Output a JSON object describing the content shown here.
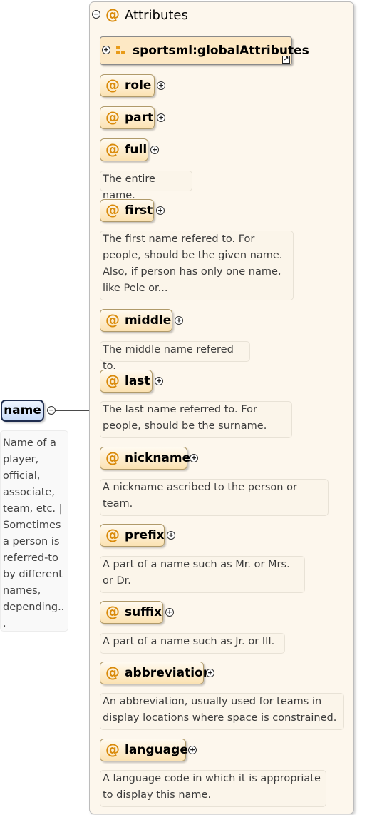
{
  "root": {
    "name": "name",
    "doc_lines": [
      "Name of a",
      "player,",
      "official,",
      "associate,",
      "team, etc. |",
      "Sometimes",
      "a person is",
      "referred-to",
      "by different",
      "names,",
      "depending..",
      "."
    ]
  },
  "group": {
    "title": "Attributes",
    "at_symbol": "@",
    "global_attributes": "sportsml:globalAttributes"
  },
  "attributes": [
    {
      "name": "role",
      "doc_lines": []
    },
    {
      "name": "part",
      "doc_lines": []
    },
    {
      "name": "full",
      "doc_lines": [
        "The entire name."
      ]
    },
    {
      "name": "first",
      "doc_lines": [
        "The first name refered to. For",
        "people, should be the given name.",
        "Also, if person has only one name,",
        "like Pele or..."
      ]
    },
    {
      "name": "middle",
      "doc_lines": [
        "The middle name refered to."
      ]
    },
    {
      "name": "last",
      "doc_lines": [
        "The last name referred to. For",
        "people, should be the surname."
      ]
    },
    {
      "name": "nickname",
      "doc_lines": [
        "A nickname ascribed to the person or",
        "team."
      ]
    },
    {
      "name": "prefix",
      "doc_lines": [
        "A part of a name such as Mr. or Mrs.",
        "or Dr."
      ]
    },
    {
      "name": "suffix",
      "doc_lines": [
        "A part of a name such as Jr. or III."
      ]
    },
    {
      "name": "abbreviation",
      "doc_lines": [
        "An abbreviation, usually used for teams in",
        "display locations where space is constrained."
      ]
    },
    {
      "name": "language",
      "doc_lines": [
        "A language code in which it is appropriate",
        "to display this name."
      ]
    }
  ],
  "icons": {
    "collapse": "collapse-minus-icon",
    "expand": "expand-plus-icon",
    "reference": "reference-arrow-icon",
    "attribute_group": "attribute-group-icon"
  },
  "colors": {
    "attribute_fill": "#fbe2b2",
    "group_background": "#fdf7ed",
    "element_fill": "#c9dcfa",
    "at_symbol": "#d98a0a"
  }
}
